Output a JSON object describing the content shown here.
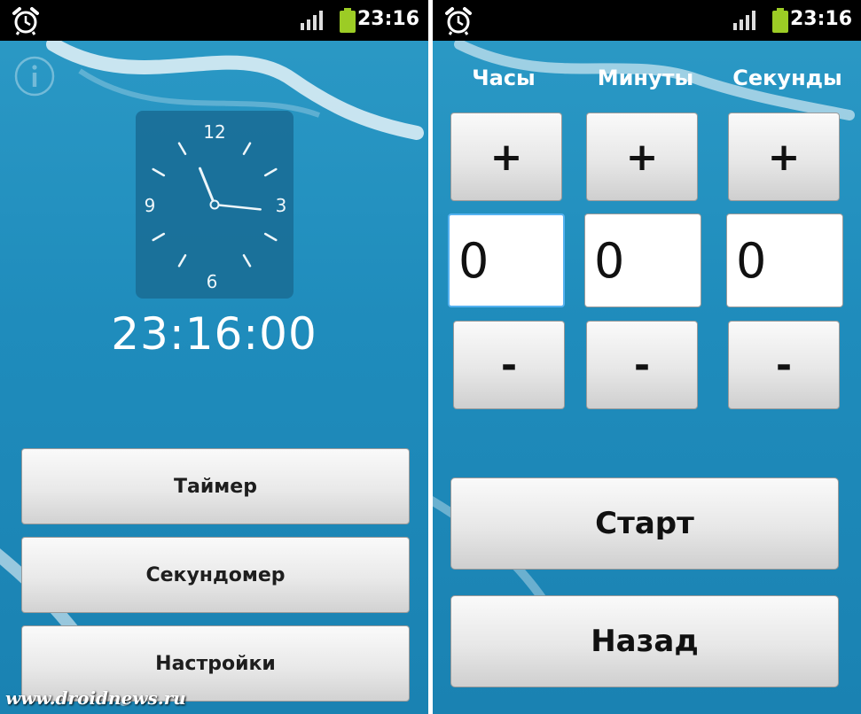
{
  "status_bar": {
    "time": "23:16",
    "icons": [
      "alarm-clock-icon",
      "signal-icon",
      "battery-icon"
    ],
    "battery_color": "#9ccc25"
  },
  "main_screen": {
    "clock": {
      "numerals": [
        "12",
        "3",
        "6",
        "9"
      ],
      "hour": 23,
      "minute": 16,
      "second": 0
    },
    "digital_time": "23:16:00",
    "menu_buttons": [
      {
        "label": "Таймер"
      },
      {
        "label": "Секундомер"
      },
      {
        "label": "Настройки"
      }
    ],
    "watermark": "www.droidnews.ru",
    "info_icon": "info-icon"
  },
  "timer_screen": {
    "columns": [
      {
        "label": "Часы",
        "plus": "+",
        "value": "0",
        "minus": "-"
      },
      {
        "label": "Минуты",
        "plus": "+",
        "value": "0",
        "minus": "-"
      },
      {
        "label": "Секунды",
        "plus": "+",
        "value": "0",
        "minus": "-"
      }
    ],
    "start_label": "Старт",
    "back_label": "Назад"
  },
  "colors": {
    "background": "#1f8cbc",
    "clock_face": "#1a6f98",
    "focus_border": "#55b2f0"
  }
}
